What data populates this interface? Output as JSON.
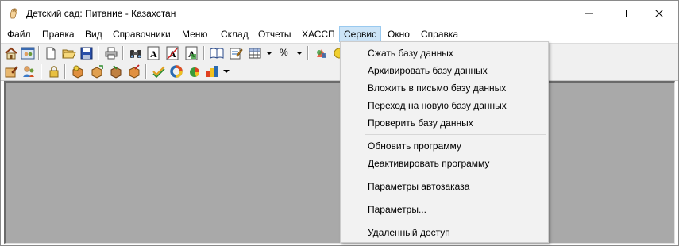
{
  "window": {
    "title": "Детский сад: Питание - Казахстан",
    "icon": "app-hand-icon",
    "controls": [
      "minimize-icon",
      "maximize-icon",
      "close-icon"
    ]
  },
  "menubar": {
    "items": [
      {
        "label": "Файл"
      },
      {
        "label": "Правка"
      },
      {
        "label": "Вид"
      },
      {
        "label": "Справочники"
      },
      {
        "label": "Меню"
      },
      {
        "label": "Склад"
      },
      {
        "label": "Отчеты"
      },
      {
        "label": "ХАССП"
      },
      {
        "label": "Сервис",
        "active": true
      },
      {
        "label": "Окно"
      },
      {
        "label": "Справка"
      }
    ]
  },
  "toolbar1": {
    "percent_label": "%"
  },
  "service_menu": {
    "items": [
      {
        "label": "Сжать базу данных"
      },
      {
        "label": "Архивировать базу данных"
      },
      {
        "label": "Вложить в письмо базу данных"
      },
      {
        "label": "Переход на новую базу данных"
      },
      {
        "label": "Проверить базу данных"
      },
      {
        "label": "Обновить программу"
      },
      {
        "label": "Деактивировать программу"
      },
      {
        "label": "Параметры автозаказа"
      },
      {
        "label": "Параметры..."
      },
      {
        "label": "Удаленный доступ"
      }
    ]
  },
  "colors": {
    "workspace": "#a9a9a9",
    "menu_highlight": "#cce4f7",
    "menu_highlight_border": "#99c9ef",
    "dropdown_bg": "#f2f2f2"
  }
}
